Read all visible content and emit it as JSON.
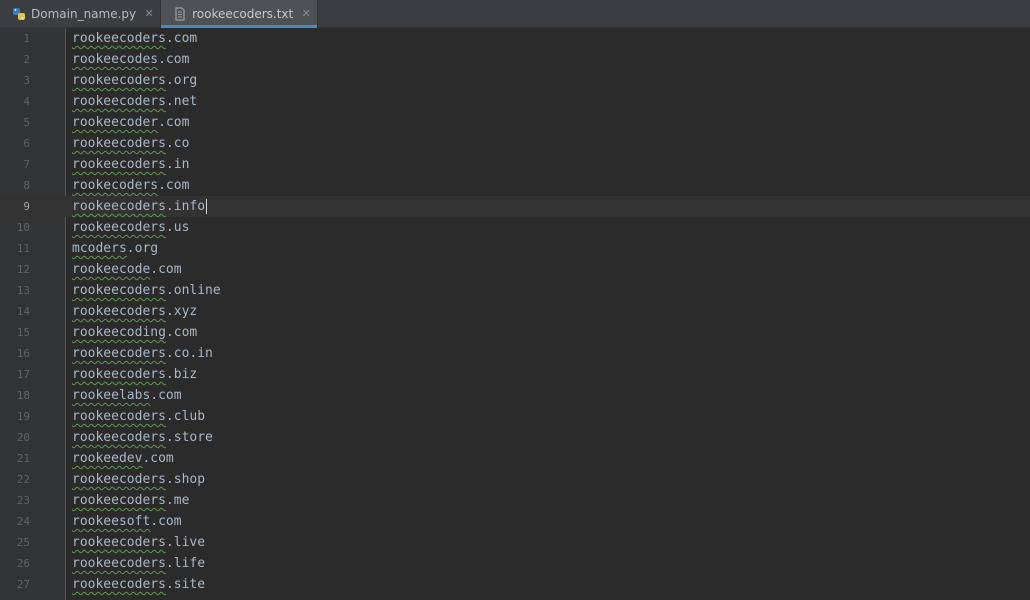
{
  "tabs": [
    {
      "label": "Domain_name.py",
      "icon": "python-file-icon",
      "active": false
    },
    {
      "label": "rookeecoders.txt",
      "icon": "text-file-icon",
      "active": true
    }
  ],
  "editor": {
    "current_line": 9,
    "lines": [
      {
        "num": "1",
        "word": "rookeecoders",
        "rest": ".com"
      },
      {
        "num": "2",
        "word": "rookeecodes",
        "rest": ".com"
      },
      {
        "num": "3",
        "word": "rookeecoders",
        "rest": ".org"
      },
      {
        "num": "4",
        "word": "rookeecoders",
        "rest": ".net"
      },
      {
        "num": "5",
        "word": "rookeecoder",
        "rest": ".com"
      },
      {
        "num": "6",
        "word": "rookeecoders",
        "rest": ".co"
      },
      {
        "num": "7",
        "word": "rookeecoders",
        "rest": ".in"
      },
      {
        "num": "8",
        "word": "rookecoders",
        "rest": ".com"
      },
      {
        "num": "9",
        "word": "rookeecoders",
        "rest": ".info"
      },
      {
        "num": "10",
        "word": "rookeecoders",
        "rest": ".us"
      },
      {
        "num": "11",
        "word": "mcoders",
        "rest": ".org"
      },
      {
        "num": "12",
        "word": "rookeecode",
        "rest": ".com"
      },
      {
        "num": "13",
        "word": "rookeecoders",
        "rest": ".online"
      },
      {
        "num": "14",
        "word": "rookeecoders",
        "rest": ".xyz"
      },
      {
        "num": "15",
        "word": "rookeecoding",
        "rest": ".com"
      },
      {
        "num": "16",
        "word": "rookeecoders",
        "rest": ".co.in"
      },
      {
        "num": "17",
        "word": "rookeecoders",
        "rest": ".biz"
      },
      {
        "num": "18",
        "word": "rookeelabs",
        "rest": ".com"
      },
      {
        "num": "19",
        "word": "rookeecoders",
        "rest": ".club"
      },
      {
        "num": "20",
        "word": "rookeecoders",
        "rest": ".store"
      },
      {
        "num": "21",
        "word": "rookeedev",
        "rest": ".com"
      },
      {
        "num": "22",
        "word": "rookeecoders",
        "rest": ".shop"
      },
      {
        "num": "23",
        "word": "rookeecoders",
        "rest": ".me"
      },
      {
        "num": "24",
        "word": "rookeesoft",
        "rest": ".com"
      },
      {
        "num": "25",
        "word": "rookeecoders",
        "rest": ".live"
      },
      {
        "num": "26",
        "word": "rookeecoders",
        "rest": ".life"
      },
      {
        "num": "27",
        "word": "rookeecoders",
        "rest": ".site"
      }
    ]
  },
  "colors": {
    "accent": "#4a88c7",
    "background": "#2b2b2b",
    "text": "#a9b7c6",
    "spellcheck": "#629755"
  }
}
